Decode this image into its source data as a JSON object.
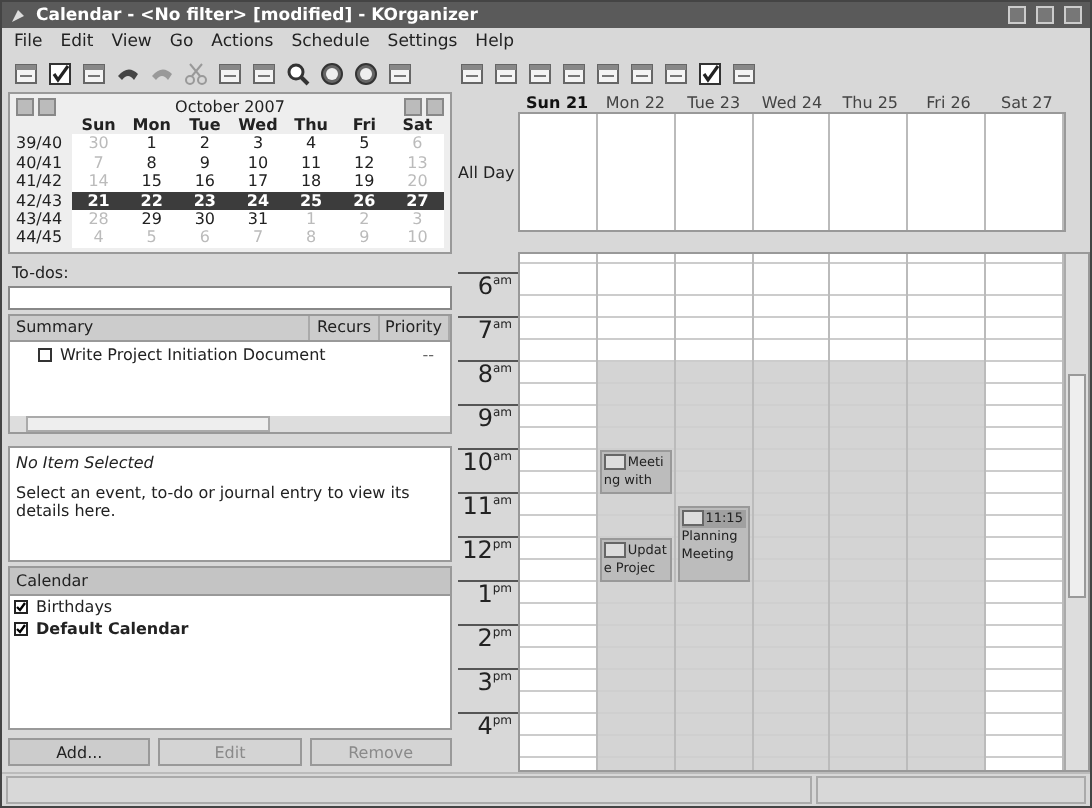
{
  "window": {
    "title": "Calendar - <No filter>  [modified] - KOrganizer"
  },
  "menu": [
    "File",
    "Edit",
    "View",
    "Go",
    "Actions",
    "Schedule",
    "Settings",
    "Help"
  ],
  "mini_calendar": {
    "title": "October 2007",
    "weekdays": [
      "Sun",
      "Mon",
      "Tue",
      "Wed",
      "Thu",
      "Fri",
      "Sat"
    ],
    "weeks": [
      {
        "number": "39/40",
        "selected": false,
        "days": [
          {
            "label": "30",
            "in_month": false
          },
          {
            "label": "1",
            "in_month": true
          },
          {
            "label": "2",
            "in_month": true
          },
          {
            "label": "3",
            "in_month": true
          },
          {
            "label": "4",
            "in_month": true
          },
          {
            "label": "5",
            "in_month": true
          },
          {
            "label": "6",
            "in_month": false
          }
        ]
      },
      {
        "number": "40/41",
        "selected": false,
        "days": [
          {
            "label": "7",
            "in_month": false
          },
          {
            "label": "8",
            "in_month": true
          },
          {
            "label": "9",
            "in_month": true
          },
          {
            "label": "10",
            "in_month": true
          },
          {
            "label": "11",
            "in_month": true
          },
          {
            "label": "12",
            "in_month": true
          },
          {
            "label": "13",
            "in_month": false
          }
        ]
      },
      {
        "number": "41/42",
        "selected": false,
        "days": [
          {
            "label": "14",
            "in_month": false
          },
          {
            "label": "15",
            "in_month": true
          },
          {
            "label": "16",
            "in_month": true
          },
          {
            "label": "17",
            "in_month": true
          },
          {
            "label": "18",
            "in_month": true
          },
          {
            "label": "19",
            "in_month": true
          },
          {
            "label": "20",
            "in_month": false
          }
        ]
      },
      {
        "number": "42/43",
        "selected": true,
        "days": [
          {
            "label": "21",
            "in_month": true
          },
          {
            "label": "22",
            "in_month": true
          },
          {
            "label": "23",
            "in_month": true
          },
          {
            "label": "24",
            "in_month": true
          },
          {
            "label": "25",
            "in_month": true
          },
          {
            "label": "26",
            "in_month": true
          },
          {
            "label": "27",
            "in_month": true
          }
        ]
      },
      {
        "number": "43/44",
        "selected": false,
        "days": [
          {
            "label": "28",
            "in_month": false
          },
          {
            "label": "29",
            "in_month": true
          },
          {
            "label": "30",
            "in_month": true
          },
          {
            "label": "31",
            "in_month": true
          },
          {
            "label": "1",
            "in_month": false
          },
          {
            "label": "2",
            "in_month": false
          },
          {
            "label": "3",
            "in_month": false
          }
        ]
      },
      {
        "number": "44/45",
        "selected": false,
        "days": [
          {
            "label": "4",
            "in_month": false
          },
          {
            "label": "5",
            "in_month": false
          },
          {
            "label": "6",
            "in_month": false
          },
          {
            "label": "7",
            "in_month": false
          },
          {
            "label": "8",
            "in_month": false
          },
          {
            "label": "9",
            "in_month": false
          },
          {
            "label": "10",
            "in_month": false
          }
        ]
      }
    ]
  },
  "todos": {
    "label": "To-dos:",
    "columns": [
      "Summary",
      "Recurs",
      "Priority"
    ],
    "items": [
      {
        "summary": "Write Project Initiation Document",
        "done": false,
        "priority": "--"
      }
    ]
  },
  "details": {
    "title": "No Item Selected",
    "text": "Select an event, to-do or journal entry to view its details here."
  },
  "calendars": {
    "header": "Calendar",
    "items": [
      {
        "name": "Birthdays",
        "checked": true,
        "default": false
      },
      {
        "name": "Default Calendar",
        "checked": true,
        "default": true
      }
    ]
  },
  "buttons": [
    {
      "label": "Add...",
      "disabled": false
    },
    {
      "label": "Edit",
      "disabled": true
    },
    {
      "label": "Remove",
      "disabled": true
    }
  ],
  "agenda": {
    "all_day_label": "All Day",
    "days": [
      {
        "label": "Sun 21",
        "today": true,
        "working": false
      },
      {
        "label": "Mon 22",
        "today": false,
        "working": true,
        "events": [
          {
            "text": "Meeting with"
          },
          {
            "text": "Update Projec"
          }
        ]
      },
      {
        "label": "Tue 23",
        "today": false,
        "working": true,
        "events": [
          {
            "time": "11:15",
            "text": "Planning Meeting"
          }
        ]
      },
      {
        "label": "Wed 24",
        "today": false,
        "working": true
      },
      {
        "label": "Thu 25",
        "today": false,
        "working": true
      },
      {
        "label": "Fri 26",
        "today": false,
        "working": true
      },
      {
        "label": "Sat 27",
        "today": false,
        "working": false
      }
    ],
    "hours": [
      {
        "hour": "6",
        "suffix": "am"
      },
      {
        "hour": "7",
        "suffix": "am"
      },
      {
        "hour": "8",
        "suffix": "am"
      },
      {
        "hour": "9",
        "suffix": "am"
      },
      {
        "hour": "10",
        "suffix": "am"
      },
      {
        "hour": "11",
        "suffix": "am"
      },
      {
        "hour": "12",
        "suffix": "pm"
      },
      {
        "hour": "1",
        "suffix": "pm"
      },
      {
        "hour": "2",
        "suffix": "pm"
      },
      {
        "hour": "3",
        "suffix": "pm"
      },
      {
        "hour": "4",
        "suffix": "pm"
      }
    ]
  }
}
